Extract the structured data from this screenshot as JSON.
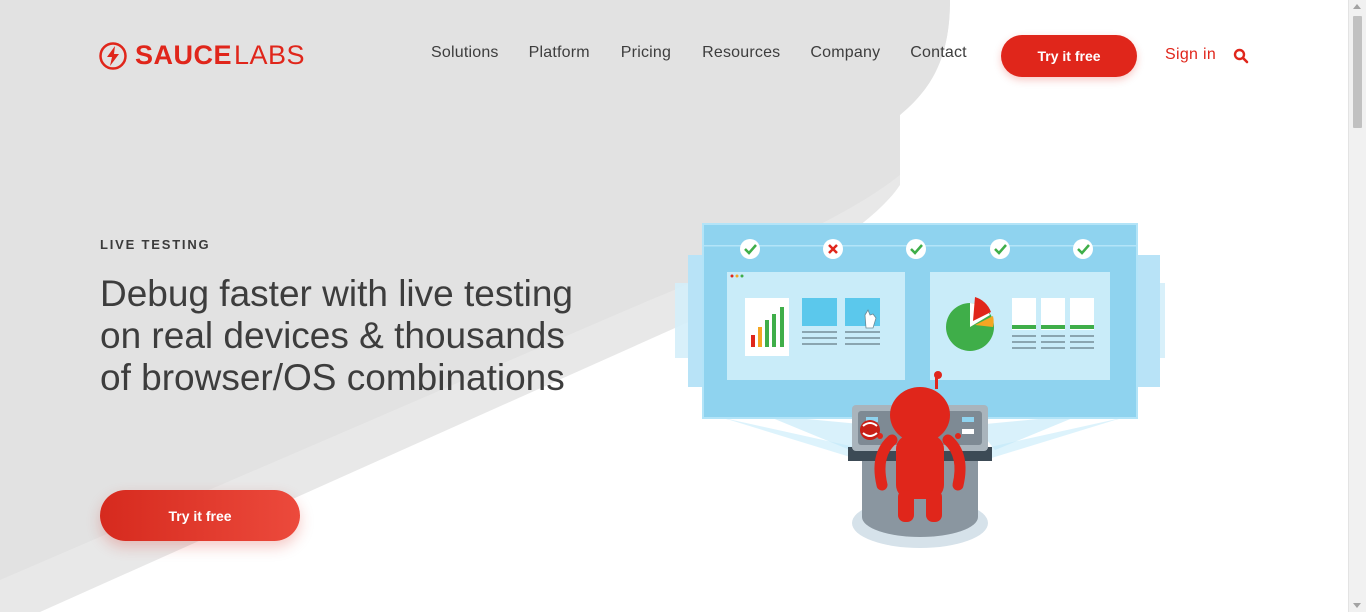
{
  "brand": {
    "name_bold": "SAUCE",
    "name_light": "LABS",
    "accent_color": "#e0261b"
  },
  "nav": {
    "items": [
      {
        "label": "Solutions"
      },
      {
        "label": "Platform"
      },
      {
        "label": "Pricing"
      },
      {
        "label": "Resources"
      },
      {
        "label": "Company"
      },
      {
        "label": "Contact"
      }
    ],
    "cta_label": "Try it free",
    "signin_label": "Sign in",
    "search_icon": "search-icon"
  },
  "hero": {
    "eyebrow": "LIVE TESTING",
    "headline": "Debug faster with live testing on real devices & thousands of browser/OS combinations",
    "cta_label": "Try it free",
    "illustration": {
      "status_icons": [
        "check",
        "cross",
        "check",
        "check",
        "check"
      ],
      "colors": {
        "screen": "#8fd3ef",
        "robot": "#e0261b",
        "pass": "#3fae49",
        "fail": "#e0261b"
      }
    }
  }
}
